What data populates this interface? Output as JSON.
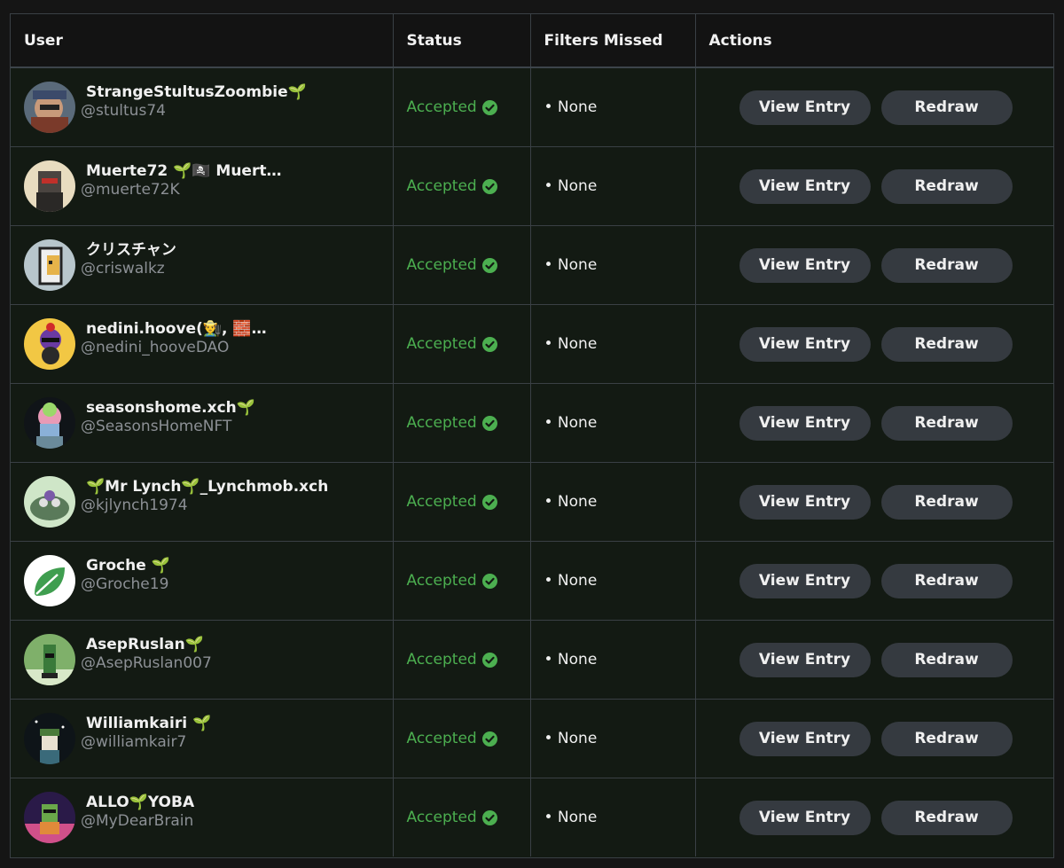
{
  "header": {
    "user": "User",
    "status": "Status",
    "filters_missed": "Filters Missed",
    "actions": "Actions"
  },
  "labels": {
    "view_entry": "View Entry",
    "redraw": "Redraw"
  },
  "colors": {
    "accepted": "#4caf50",
    "button_bg": "#353a40",
    "row_bg": "#131a13"
  },
  "rows": [
    {
      "name": "StrangeStultusZoombie🌱",
      "handle": "@stultus74",
      "status": "Accepted",
      "filters": "• None",
      "avatar": "zombie-avatar"
    },
    {
      "name": "Muerte72 🌱🏴‍☠️ Muert…",
      "handle": "@muerte72K",
      "status": "Accepted",
      "filters": "• None",
      "avatar": "muerte-avatar"
    },
    {
      "name": "クリスチャン",
      "handle": "@criswalkz",
      "status": "Accepted",
      "filters": "• None",
      "avatar": "pixel-avatar"
    },
    {
      "name": "nedini.hoove(👨‍🌾, 🧱…",
      "handle": "@nedini_hooveDAO",
      "status": "Accepted",
      "filters": "• None",
      "avatar": "nedini-avatar"
    },
    {
      "name": "seasonshome.xch🌱",
      "handle": "@SeasonsHomeNFT",
      "status": "Accepted",
      "filters": "• None",
      "avatar": "seasons-avatar"
    },
    {
      "name": "🌱Mr Lynch🌱_Lynchmob.xch",
      "handle": "@kjlynch1974",
      "status": "Accepted",
      "filters": "• None",
      "avatar": "lynch-avatar"
    },
    {
      "name": "Groche 🌱",
      "handle": "@Groche19",
      "status": "Accepted",
      "filters": "• None",
      "avatar": "leaf-avatar"
    },
    {
      "name": "AsepRuslan🌱",
      "handle": "@AsepRuslan007",
      "status": "Accepted",
      "filters": "• None",
      "avatar": "asep-avatar"
    },
    {
      "name": "Williamkairi 🌱",
      "handle": "@williamkair7",
      "status": "Accepted",
      "filters": "• None",
      "avatar": "william-avatar"
    },
    {
      "name": "ALLO🌱YOBA",
      "handle": "@MyDearBrain",
      "status": "Accepted",
      "filters": "• None",
      "avatar": "allo-avatar"
    }
  ]
}
